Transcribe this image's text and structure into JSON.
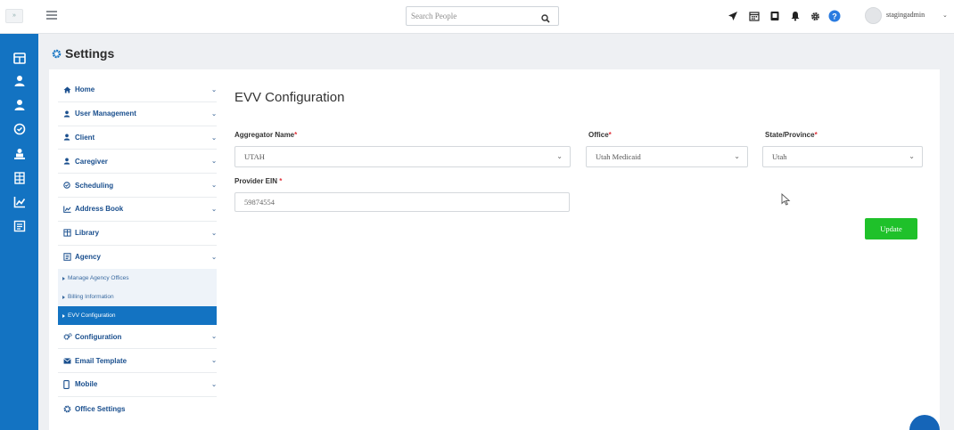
{
  "topbar": {
    "logo_text": "»",
    "search_placeholder": "Search People",
    "icons": [
      "rocket-icon",
      "calendar-icon",
      "book-icon",
      "bell-icon",
      "gear-icon",
      "help-icon"
    ],
    "username": "stagingadmin",
    "colors": {
      "icon": "#222222",
      "help": "#2a7be0"
    }
  },
  "rail": {
    "icons": [
      "dashboard-icon",
      "client-icon",
      "caregiver-icon",
      "scheduling-icon",
      "billing-icon",
      "payroll-icon",
      "reports-icon",
      "documents-icon"
    ],
    "color": "#1373c2"
  },
  "page": {
    "title": "Settings"
  },
  "menu": {
    "items": [
      {
        "label": "Home",
        "icon": "home-icon"
      },
      {
        "label": "User Management",
        "icon": "user-icon"
      },
      {
        "label": "Client",
        "icon": "user-icon"
      },
      {
        "label": "Caregiver",
        "icon": "user-icon"
      },
      {
        "label": "Scheduling",
        "icon": "clock-icon"
      },
      {
        "label": "Address Book",
        "icon": "chart-icon"
      },
      {
        "label": "Library",
        "icon": "library-icon"
      },
      {
        "label": "Agency",
        "icon": "agency-icon"
      }
    ],
    "agency_sub": [
      {
        "label": "Manage Agency Offices"
      },
      {
        "label": "Billing Information"
      },
      {
        "label": "EVV Configuration",
        "active": true
      }
    ],
    "items_after": [
      {
        "label": "Configuration",
        "icon": "cogs-icon"
      },
      {
        "label": "Email Template",
        "icon": "envelope-icon"
      },
      {
        "label": "Mobile",
        "icon": "mobile-icon"
      },
      {
        "label": "Office Settings",
        "icon": "gear-icon"
      }
    ]
  },
  "form": {
    "title": "EVV Configuration",
    "aggregator": {
      "label": "Aggregator Name",
      "value": "UTAH"
    },
    "office": {
      "label": "Office",
      "value": "Utah Medicaid"
    },
    "state": {
      "label": "State/Province",
      "value": "Utah"
    },
    "ein": {
      "label": "Provider EIN",
      "value": "59874554"
    },
    "required_mark": "*",
    "update_label": "Update",
    "accent": "#1fc12a"
  }
}
